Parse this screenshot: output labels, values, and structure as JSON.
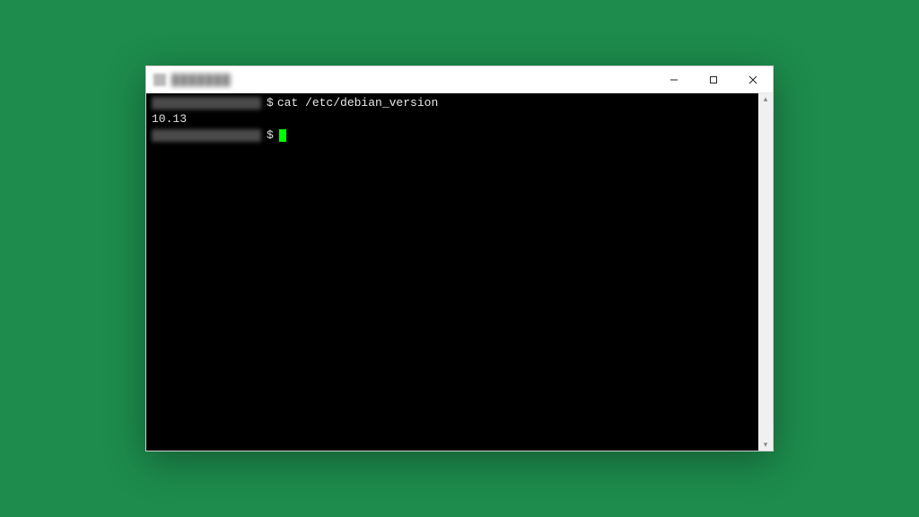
{
  "window": {
    "title_redacted": "███████"
  },
  "terminal": {
    "line1": {
      "prompt_redacted": "user@host:~",
      "dollar": "$",
      "command": "cat /etc/debian_version"
    },
    "output": "10.13",
    "line2": {
      "prompt_redacted": "user@host:~",
      "dollar": "$"
    }
  },
  "colors": {
    "background": "#1d8c4c",
    "terminal_bg": "#000000",
    "terminal_fg": "#e0e0e0",
    "cursor": "#00ff00"
  }
}
